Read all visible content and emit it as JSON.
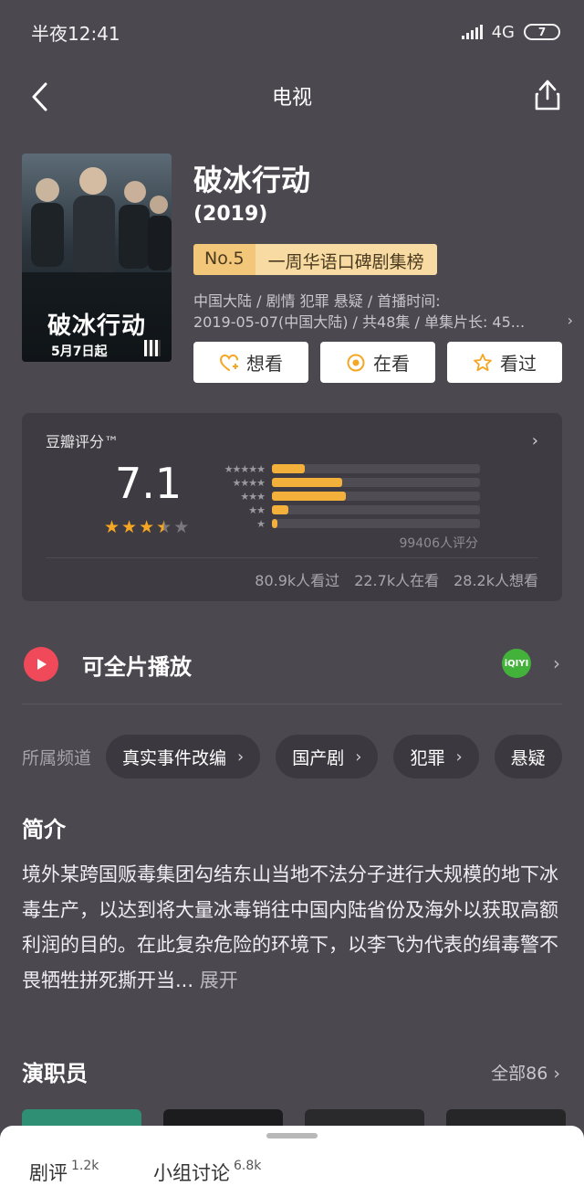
{
  "status_bar": {
    "time": "半夜12:41",
    "network": "4G",
    "battery": "7"
  },
  "nav": {
    "title": "电视",
    "back_icon": "back-arrow-icon",
    "share_icon": "share-icon"
  },
  "poster": {
    "title": "破冰行动",
    "date": "5月7日起"
  },
  "show": {
    "title": "破冰行动",
    "year": "(2019)",
    "rank_no": "No.5",
    "rank_label": "一周华语口碑剧集榜",
    "meta_line1": "中国大陆 / 剧情 犯罪 悬疑 / 首播时间:",
    "meta_line2": "2019-05-07(中国大陆) / 共48集 / 单集片长: 45...",
    "meta_more": "›"
  },
  "actions": {
    "want": "想看",
    "watching": "在看",
    "watched": "看过"
  },
  "rating": {
    "label": "豆瓣评分™",
    "score": "7.1",
    "stars_value": 3.5,
    "count": "99406人评分",
    "distribution_percent": [
      8,
      17,
      18,
      4,
      1
    ],
    "watched": "80.9k人看过",
    "watching": "22.7k人在看",
    "want": "28.2k人想看"
  },
  "play": {
    "label": "可全片播放",
    "provider_icon": "iqiyi-icon",
    "provider_text": "iQIYI"
  },
  "channels": {
    "label": "所属频道",
    "items": [
      "真实事件改编",
      "国产剧",
      "犯罪",
      "悬疑"
    ]
  },
  "intro": {
    "title": "简介",
    "text": "境外某跨国贩毒集团勾结东山当地不法分子进行大规模的地下冰毒生产，以达到将大量冰毒销往中国内陆省份及海外以获取高额利润的目的。在此复杂危险的环境下，以李飞为代表的缉毒警不畏牺牲拼死撕开当...",
    "expand": "展开"
  },
  "cast": {
    "title": "演职员",
    "all": "全部86 ›"
  },
  "bottom_sheet": {
    "tab1_label": "剧评",
    "tab1_count": "1.2k",
    "tab2_label": "小组讨论",
    "tab2_count": "6.8k"
  },
  "colors": {
    "background": "#4b4850",
    "card": "#3e3c42",
    "accent_star": "#f5a623",
    "bar": "#f3b13c",
    "play": "#f04a5a",
    "iqiyi": "#43b23a",
    "rank_badge": "#f3c77a"
  }
}
